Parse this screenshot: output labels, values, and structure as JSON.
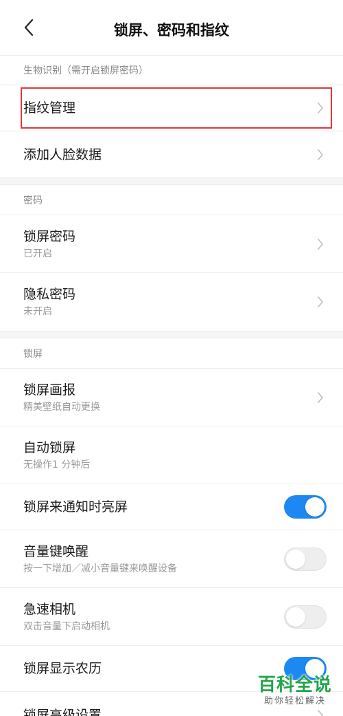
{
  "header": {
    "title": "锁屏、密码和指纹",
    "back_icon": "chevron-left-icon"
  },
  "sections": {
    "biometrics": {
      "header": "生物识别（需开启锁屏密码）",
      "items": [
        {
          "title": "指纹管理",
          "highlighted": true
        },
        {
          "title": "添加人脸数据"
        }
      ]
    },
    "password": {
      "header": "密码",
      "items": [
        {
          "title": "锁屏密码",
          "subtitle": "已开启"
        },
        {
          "title": "隐私密码",
          "subtitle": "未开启"
        }
      ]
    },
    "lockscreen": {
      "header": "锁屏",
      "items": [
        {
          "title": "锁屏画报",
          "subtitle": "精美壁纸自动更换"
        },
        {
          "title": "自动锁屏",
          "subtitle": "无操作1 分钟后"
        },
        {
          "title": "锁屏来通知时亮屏",
          "toggle": "on"
        },
        {
          "title": "音量键唤醒",
          "subtitle": "按一下增加／减小音量键来唤醒设备",
          "toggle": "off"
        },
        {
          "title": "急速相机",
          "subtitle": "双击音量下启动相机",
          "toggle": "off"
        },
        {
          "title": "锁屏显示农历",
          "toggle": "on"
        },
        {
          "title": "锁屏高级设置"
        }
      ]
    }
  },
  "watermark": {
    "main": "百科全说",
    "sub": "助你轻松解决"
  },
  "colors": {
    "accent": "#1d88f2",
    "highlight_border": "#d93a3a",
    "watermark_green": "#23a54a"
  }
}
